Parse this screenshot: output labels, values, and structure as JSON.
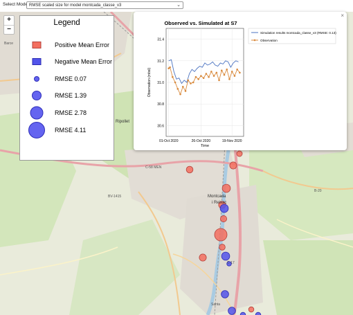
{
  "topbar": {
    "label": "Select Model:",
    "selected": "RMSE scaled size for model montcada_classe_v3"
  },
  "zoom": {
    "in": "+",
    "out": "−"
  },
  "legend": {
    "title": "Legend",
    "items": [
      {
        "kind": "positive",
        "label": "Positive Mean Error"
      },
      {
        "kind": "negative",
        "label": "Negative Mean Error"
      },
      {
        "kind": "rmse",
        "value": 0.07,
        "label": "RMSE 0.07"
      },
      {
        "kind": "rmse",
        "value": 1.39,
        "label": "RMSE 1.39"
      },
      {
        "kind": "rmse",
        "value": 2.78,
        "label": "RMSE 2.78"
      },
      {
        "kind": "rmse",
        "value": 4.11,
        "label": "RMSE 4.11"
      }
    ],
    "colors": {
      "positive": "#f36f5f",
      "negative": "#5254ea"
    }
  },
  "popup": {
    "close": "×"
  },
  "map_labels": {
    "barcelona": "Barce",
    "ripollet": "Ripollet",
    "montcada": "Montcada",
    "reixac": "i Reixac",
    "c33": "C-33",
    "c58": "C-58 MEN",
    "b20": "B-20",
    "bv1415": "BV-1415",
    "c17": "C-17",
    "santa": "Santa"
  },
  "markers": [
    {
      "sign": "positive",
      "rmse": 0.6
    },
    {
      "sign": "positive",
      "rmse": 1.0
    },
    {
      "sign": "positive",
      "rmse": 0.9
    },
    {
      "sign": "positive",
      "rmse": 1.3
    },
    {
      "sign": "positive",
      "rmse": 1.0
    },
    {
      "sign": "negative",
      "rmse": 1.3
    },
    {
      "sign": "positive",
      "rmse": 0.8
    },
    {
      "sign": "positive",
      "rmse": 2.5
    },
    {
      "sign": "positive",
      "rmse": 0.7
    },
    {
      "sign": "negative",
      "rmse": 1.3
    },
    {
      "sign": "positive",
      "rmse": 1.0
    },
    {
      "sign": "negative",
      "rmse": 0.3
    },
    {
      "sign": "negative",
      "rmse": 1.1
    },
    {
      "sign": "negative",
      "rmse": 1.1
    },
    {
      "sign": "negative",
      "rmse": 0.5
    },
    {
      "sign": "positive",
      "rmse": 0.5
    },
    {
      "sign": "negative",
      "rmse": 0.5
    }
  ],
  "chart_data": {
    "type": "line",
    "title": "Observed vs. Simulated at S7",
    "xlabel": "Time",
    "ylabel": "Observation (mbsl)",
    "x_ticks": [
      "01-Oct 2020",
      "26-Oct 2020",
      "19-Nov 2020"
    ],
    "y_ticks": [
      30.6,
      30.8,
      31.0,
      31.2,
      31.4
    ],
    "ylim": [
      30.5,
      31.5
    ],
    "xlim": [
      "2020-09-29",
      "2020-11-28"
    ],
    "legend_position": "top-right",
    "series": [
      {
        "name": "Simulation results montcada_classe_v3 (RMSE: 0.13)",
        "color": "#4a72c0",
        "x": [
          "2020-10-01",
          "2020-10-03",
          "2020-10-05",
          "2020-10-07",
          "2020-10-09",
          "2020-10-11",
          "2020-10-13",
          "2020-10-15",
          "2020-10-17",
          "2020-10-19",
          "2020-10-21",
          "2020-10-23",
          "2020-10-25",
          "2020-10-27",
          "2020-10-29",
          "2020-10-31",
          "2020-11-02",
          "2020-11-04",
          "2020-11-06",
          "2020-11-08",
          "2020-11-10",
          "2020-11-12",
          "2020-11-14",
          "2020-11-16",
          "2020-11-18",
          "2020-11-20",
          "2020-11-22",
          "2020-11-24"
        ],
        "values": [
          31.2,
          31.21,
          31.1,
          31.03,
          31.04,
          30.99,
          31.02,
          31.0,
          31.08,
          31.12,
          31.1,
          31.13,
          31.15,
          31.14,
          31.18,
          31.16,
          31.17,
          31.19,
          31.16,
          31.15,
          31.18,
          31.17,
          31.2,
          31.19,
          31.14,
          31.18,
          31.2,
          31.19
        ]
      },
      {
        "name": "Observation",
        "color": "#d98a3d",
        "x": [
          "2020-10-01",
          "2020-10-02",
          "2020-10-04",
          "2020-10-06",
          "2020-10-08",
          "2020-10-10",
          "2020-10-12",
          "2020-10-14",
          "2020-10-16",
          "2020-10-18",
          "2020-10-20",
          "2020-10-22",
          "2020-10-24",
          "2020-10-26",
          "2020-10-28",
          "2020-10-30",
          "2020-11-01",
          "2020-11-03",
          "2020-11-05",
          "2020-11-07",
          "2020-11-09",
          "2020-11-11",
          "2020-11-13",
          "2020-11-15",
          "2020-11-17",
          "2020-11-19",
          "2020-11-21",
          "2020-11-23",
          "2020-11-25"
        ],
        "values": [
          31.13,
          31.14,
          31.05,
          31.0,
          30.94,
          30.89,
          30.96,
          30.92,
          31.02,
          30.99,
          31.0,
          31.05,
          31.03,
          31.06,
          31.04,
          31.08,
          31.05,
          31.1,
          31.06,
          31.09,
          31.02,
          31.11,
          31.07,
          31.12,
          31.03,
          31.1,
          31.06,
          31.12,
          31.09
        ]
      }
    ]
  }
}
